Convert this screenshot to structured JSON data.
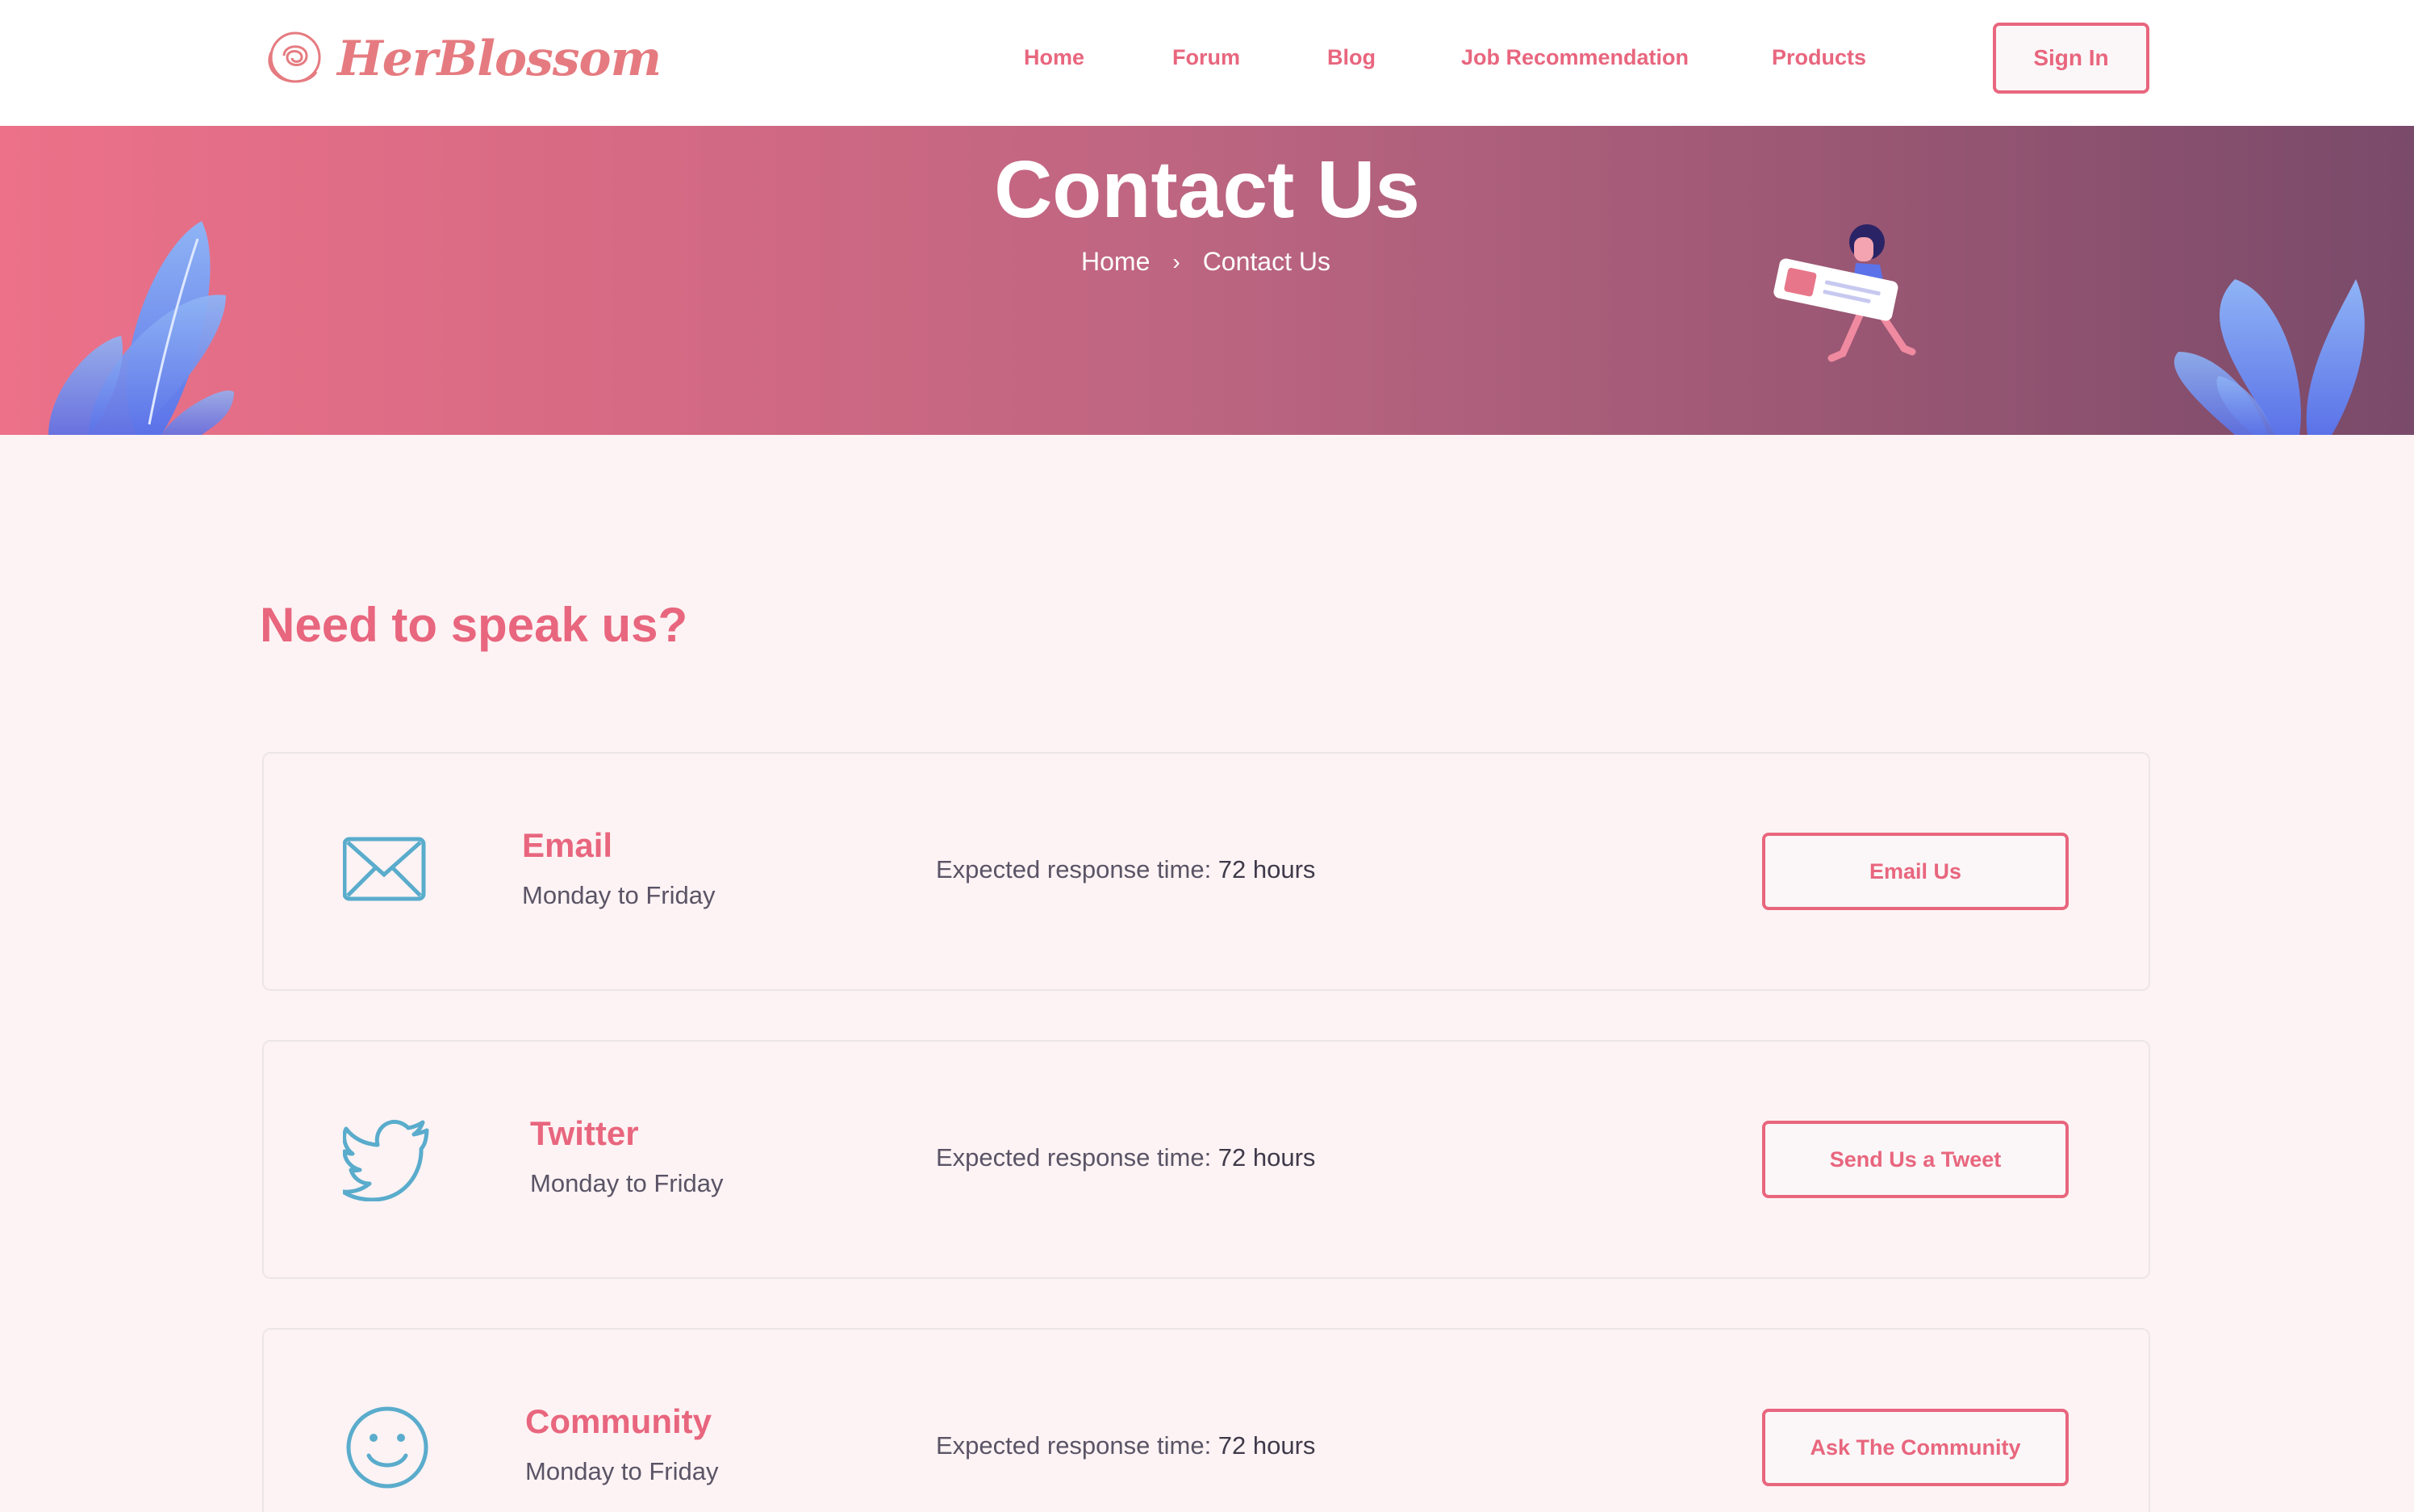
{
  "header": {
    "logo_text": "HerBlossom",
    "nav": [
      "Home",
      "Forum",
      "Blog",
      "Job Recommendation",
      "Products"
    ],
    "signin_label": "Sign In"
  },
  "hero": {
    "title": "Contact Us",
    "breadcrumb": [
      "Home",
      "Contact Us"
    ]
  },
  "main": {
    "section_title": "Need to speak us?",
    "cards": [
      {
        "title": "Email",
        "subtitle": "Monday to Friday",
        "response_label": "Expected response time: ",
        "response_value": "72 hours",
        "button": "Email Us",
        "icon": "envelope-icon"
      },
      {
        "title": "Twitter",
        "subtitle": "Monday to Friday",
        "response_label": "Expected response time: ",
        "response_value": "72 hours",
        "button": "Send Us a Tweet",
        "icon": "twitter-icon"
      },
      {
        "title": "Community",
        "subtitle": "Monday to Friday",
        "response_label": "Expected response time: ",
        "response_value": "72 hours",
        "button": "Ask The Community",
        "icon": "smiley-icon"
      }
    ]
  },
  "colors": {
    "accent": "#e8667e",
    "icon_blue": "#5aaccc",
    "background": "#fdf3f4",
    "hero_start": "#ec7189",
    "hero_end": "#7a4a6a"
  }
}
